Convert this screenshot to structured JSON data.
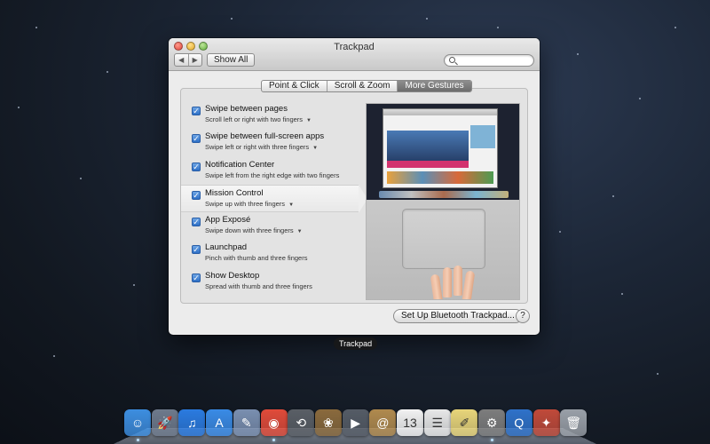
{
  "window": {
    "title": "Trackpad",
    "nav_back": "◀",
    "nav_forward": "▶",
    "show_all": "Show All",
    "search_placeholder": ""
  },
  "tabs": [
    {
      "label": "Point & Click",
      "active": false
    },
    {
      "label": "Scroll & Zoom",
      "active": false
    },
    {
      "label": "More Gestures",
      "active": true
    }
  ],
  "gestures": [
    {
      "title": "Swipe between pages",
      "subtitle": "Scroll left or right with two fingers",
      "checked": true,
      "has_menu": true
    },
    {
      "title": "Swipe between full-screen apps",
      "subtitle": "Swipe left or right with three fingers",
      "checked": true,
      "has_menu": true
    },
    {
      "title": "Notification Center",
      "subtitle": "Swipe left from the right edge with two fingers",
      "checked": true,
      "has_menu": false
    },
    {
      "title": "Mission Control",
      "subtitle": "Swipe up with three fingers",
      "checked": true,
      "has_menu": true,
      "selected": true
    },
    {
      "title": "App Exposé",
      "subtitle": "Swipe down with three fingers",
      "checked": true,
      "has_menu": true
    },
    {
      "title": "Launchpad",
      "subtitle": "Pinch with thumb and three fingers",
      "checked": true,
      "has_menu": false
    },
    {
      "title": "Show Desktop",
      "subtitle": "Spread with thumb and three fingers",
      "checked": true,
      "has_menu": false
    }
  ],
  "footer": {
    "bluetooth_button": "Set Up Bluetooth Trackpad...",
    "help": "?"
  },
  "dock": {
    "hover_label": "Trackpad",
    "apps": [
      {
        "name": "finder-icon",
        "color": "#3d8ee0",
        "glyph": "☺",
        "running": true
      },
      {
        "name": "launchpad-icon",
        "color": "#6e7a8c",
        "glyph": "🚀",
        "running": false
      },
      {
        "name": "itunes-icon",
        "color": "#2b7be0",
        "glyph": "♫",
        "running": false
      },
      {
        "name": "app-store-icon",
        "color": "#3a8be6",
        "glyph": "A",
        "running": false
      },
      {
        "name": "preview-icon",
        "color": "#7a8fb0",
        "glyph": "✎",
        "running": false
      },
      {
        "name": "chrome-icon",
        "color": "#e04b3a",
        "glyph": "◉",
        "running": true
      },
      {
        "name": "time-machine-icon",
        "color": "#5a5f66",
        "glyph": "⟲",
        "running": false
      },
      {
        "name": "iphoto-icon",
        "color": "#8a6a3d",
        "glyph": "❀",
        "running": false
      },
      {
        "name": "facetime-icon",
        "color": "#555c66",
        "glyph": "▶",
        "running": false
      },
      {
        "name": "contacts-icon",
        "color": "#b08a4e",
        "glyph": "@",
        "running": false
      },
      {
        "name": "calendar-icon",
        "color": "#f2f2f2",
        "glyph": "13",
        "running": false
      },
      {
        "name": "reminders-icon",
        "color": "#e8e8e8",
        "glyph": "☰",
        "running": false
      },
      {
        "name": "notes-icon",
        "color": "#e8d57a",
        "glyph": "✐",
        "running": false
      },
      {
        "name": "system-preferences-icon",
        "color": "#7d7d7d",
        "glyph": "⚙",
        "running": true
      },
      {
        "name": "quicktime-icon",
        "color": "#2f72c9",
        "glyph": "Q",
        "running": false
      },
      {
        "name": "app-icon",
        "color": "#c04a3a",
        "glyph": "✦",
        "running": false
      },
      {
        "name": "trash-icon",
        "color": "#9aa0a8",
        "glyph": "🗑",
        "running": false
      }
    ]
  }
}
